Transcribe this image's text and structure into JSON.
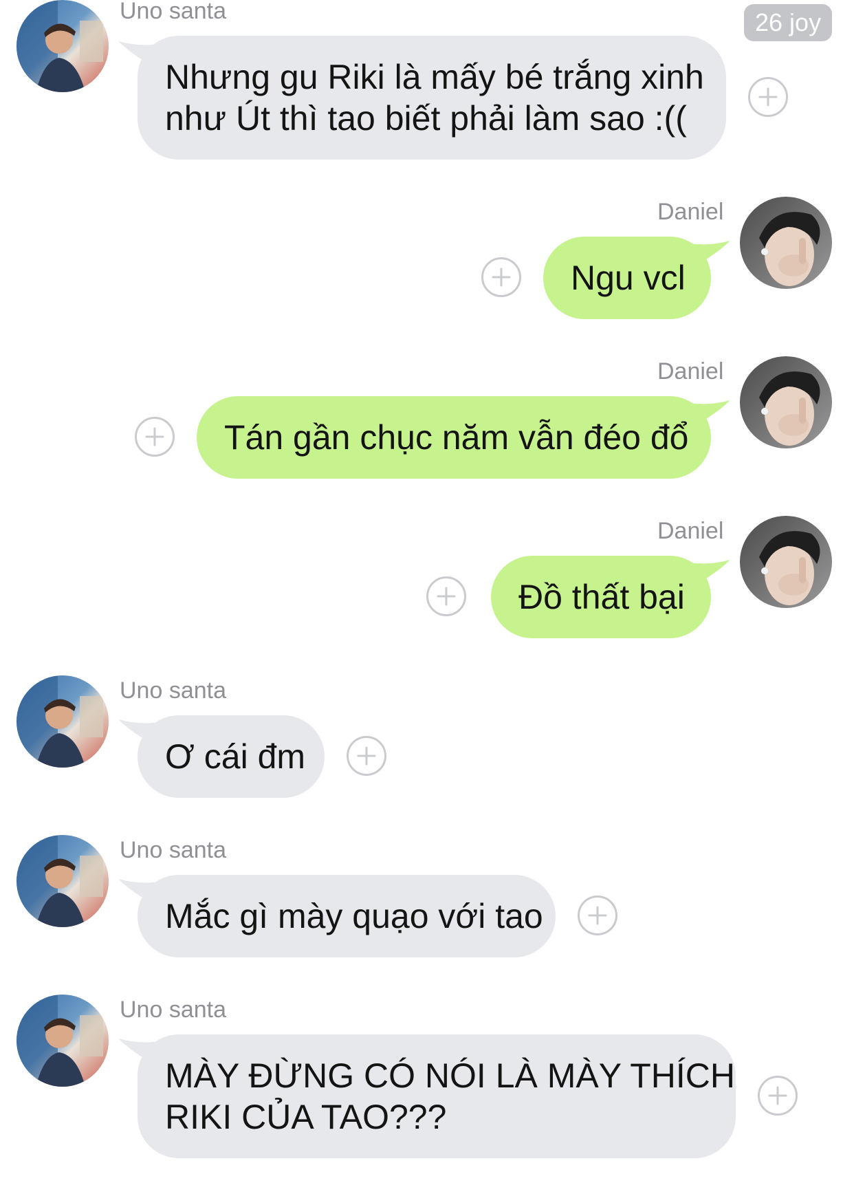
{
  "time_badge": "26 joy",
  "messages": [
    {
      "sender": "Uno santa",
      "side": "left",
      "text_lines": [
        "Nhưng gu Riki là mấy bé trắng xinh",
        "như Út thì tao biết phải làm sao :(("
      ]
    },
    {
      "sender": "Daniel",
      "side": "right",
      "text_lines": [
        "Ngu vcl"
      ]
    },
    {
      "sender": "Daniel",
      "side": "right",
      "text_lines": [
        "Tán gần chục năm vẫn đéo đổ"
      ]
    },
    {
      "sender": "Daniel",
      "side": "right",
      "text_lines": [
        "Đồ thất bại"
      ]
    },
    {
      "sender": "Uno santa",
      "side": "left",
      "text_lines": [
        "Ơ cái đm"
      ]
    },
    {
      "sender": "Uno santa",
      "side": "left",
      "text_lines": [
        "Mắc gì mày quạo với tao"
      ]
    },
    {
      "sender": "Uno santa",
      "side": "left",
      "text_lines": [
        "MÀY ĐỪNG CÓ NÓI LÀ MÀY THÍCH",
        "RIKI CỦA TAO???"
      ]
    }
  ],
  "colors": {
    "incoming_bubble": "#e6e8ec",
    "outgoing_bubble": "#c7f38f",
    "sender_name": "#8e9095",
    "add_icon": "#c9cbcf"
  }
}
